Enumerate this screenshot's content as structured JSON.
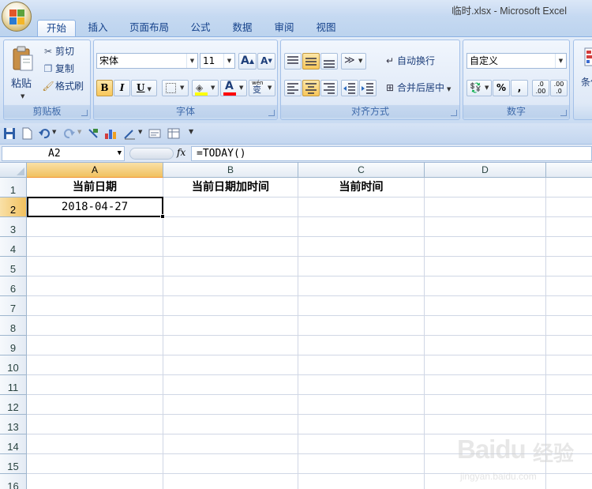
{
  "window": {
    "title": "临时.xlsx - Microsoft Excel"
  },
  "ribbon": {
    "tabs": [
      {
        "label": "开始",
        "active": true
      },
      {
        "label": "插入"
      },
      {
        "label": "页面布局"
      },
      {
        "label": "公式"
      },
      {
        "label": "数据"
      },
      {
        "label": "审阅"
      },
      {
        "label": "视图"
      }
    ],
    "clipboard": {
      "group_label": "剪贴板",
      "paste_label": "粘贴",
      "cut_label": "剪切",
      "copy_label": "复制",
      "format_painter_label": "格式刷"
    },
    "font": {
      "group_label": "字体",
      "font_name": "宋体",
      "font_size": "11",
      "grow_label": "A",
      "shrink_label": "A",
      "bold_label": "B",
      "italic_label": "I",
      "underline_label": "U",
      "font_color_label": "A",
      "phonetic_label": "wén",
      "phonetic_char": "变",
      "fill_color": "#ffff00",
      "font_color": "#ff0000"
    },
    "alignment": {
      "group_label": "对齐方式",
      "wrap_label": "自动换行",
      "merge_label": "合并后居中"
    },
    "number": {
      "group_label": "数字",
      "format": "自定义",
      "percent_label": "%",
      "comma_label": ",",
      "inc_decimal_label": ".0\n.00",
      "dec_decimal_label": ".00\n.0"
    },
    "styles": {
      "partial_label": "条件"
    }
  },
  "formula_bar": {
    "name_box": "A2",
    "fx_label": "fx",
    "formula": "=TODAY()"
  },
  "sheet": {
    "columns": [
      "A",
      "B",
      "C",
      "D"
    ],
    "rows": [
      "1",
      "2",
      "3",
      "4",
      "5",
      "6",
      "7",
      "8",
      "9",
      "10",
      "11",
      "12",
      "13",
      "14",
      "15",
      "16"
    ],
    "cells": {
      "A1": "当前日期",
      "B1": "当前日期加时间",
      "C1": "当前时间",
      "A2": "2018-04-27"
    },
    "selected": "A2"
  },
  "watermark": {
    "brand": "Baidu",
    "chinese": "经验",
    "url": "jingyan.baidu.com"
  }
}
